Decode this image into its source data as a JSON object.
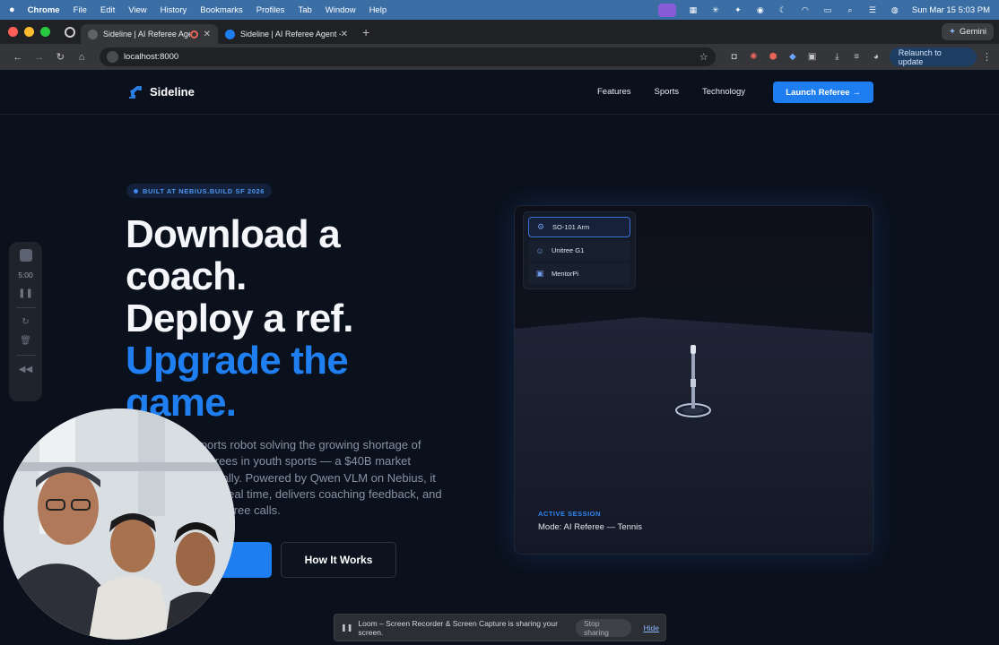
{
  "menubar": {
    "apple": "",
    "app": "Chrome",
    "menus": [
      "File",
      "Edit",
      "View",
      "History",
      "Bookmarks",
      "Profiles",
      "Tab",
      "Window",
      "Help"
    ],
    "datetime": "Sun Mar 15  5:03 PM"
  },
  "tabs": [
    {
      "title": "Sideline | AI Referee Agent",
      "active": true
    },
    {
      "title": "Sideline | AI Referee Agent - ",
      "active": false
    }
  ],
  "gemini_label": "Gemini",
  "address": {
    "url": "localhost:8000",
    "relaunch_label": "Relaunch to update"
  },
  "site": {
    "brand": "Sideline",
    "nav_links": [
      "Features",
      "Sports",
      "Technology"
    ],
    "cta": "Launch Referee →",
    "badge": "BUILT AT NEBIUS.BUILD SF 2026",
    "headline_lines": [
      "Download a",
      "coach.",
      "Deploy a ref."
    ],
    "headline_blue_lines": [
      "Upgrade the",
      "game."
    ],
    "description": "A modular AI sports robot solving the growing shortage of coaches and referees in youth sports — a $40B market growing 10% annually. Powered by Qwen VLM on Nebius, it reads gameplay in real time, delivers coaching feedback, and makes unbiased referee calls.",
    "primary_button_icon": "→",
    "secondary_button": "How It Works"
  },
  "viewer": {
    "robots": [
      {
        "name": "SO-101 Arm",
        "icon": "arm-icon",
        "selected": true
      },
      {
        "name": "Unitree G1",
        "icon": "humanoid-icon",
        "selected": false
      },
      {
        "name": "MentorPi",
        "icon": "rover-icon",
        "selected": false
      }
    ],
    "session_label": "ACTIVE SESSION",
    "session_mode": "Mode: AI Referee — Tennis"
  },
  "loom": {
    "timer": "5:00",
    "share_message": "Loom – Screen Recorder & Screen Capture is sharing your screen.",
    "stop_label": "Stop sharing",
    "hide_label": "Hide"
  },
  "colors": {
    "accent": "#1e7ef0",
    "background": "#0b111c",
    "menubar": "#3a6ea5"
  }
}
